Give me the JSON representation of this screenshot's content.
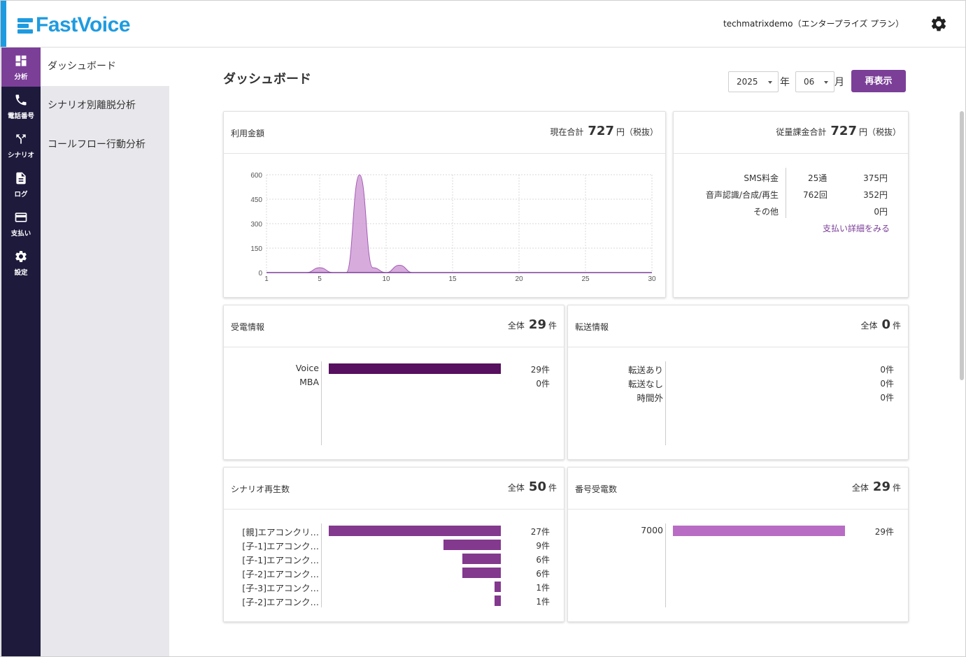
{
  "app": {
    "name": "FastVoice",
    "brand_color": "#1e9be0",
    "accent": "#7b3f98"
  },
  "header": {
    "account": "techmatrixdemo（エンタープライズ プラン）",
    "settings_icon": "gear-icon"
  },
  "rail": [
    {
      "label": "分析",
      "icon": "dashboard-icon"
    },
    {
      "label": "電話番号",
      "icon": "phone-icon"
    },
    {
      "label": "シナリオ",
      "icon": "fork-icon"
    },
    {
      "label": "ログ",
      "icon": "document-icon"
    },
    {
      "label": "支払い",
      "icon": "credit-card-icon"
    },
    {
      "label": "設定",
      "icon": "gear-icon"
    }
  ],
  "subnav": [
    "ダッシュボード",
    "シナリオ別離脱分析",
    "コールフロー行動分析"
  ],
  "page": {
    "title": "ダッシュボード",
    "year": "2025",
    "year_unit": "年",
    "month": "06",
    "month_unit": "月",
    "refresh": "再表示"
  },
  "usage": {
    "title": "利用金額",
    "total_label": "現在合計",
    "total": "727",
    "total_unit": "円（税抜）",
    "chart_data": {
      "type": "area",
      "x": [
        1,
        2,
        3,
        4,
        5,
        6,
        7,
        8,
        9,
        10,
        11,
        12,
        13,
        14,
        15,
        16,
        17,
        18,
        19,
        20,
        21,
        22,
        23,
        24,
        25,
        26,
        27,
        28,
        29,
        30
      ],
      "y": [
        0,
        0,
        0,
        0,
        30,
        0,
        0,
        600,
        30,
        0,
        45,
        0,
        0,
        0,
        0,
        0,
        0,
        0,
        0,
        0,
        0,
        0,
        0,
        0,
        0,
        0,
        0,
        0,
        0,
        0
      ],
      "xticks": [
        "1",
        "5",
        "10",
        "15",
        "20",
        "25",
        "30"
      ],
      "yticks": [
        "600",
        "450",
        "300",
        "150",
        "0"
      ],
      "ylim": [
        0,
        600
      ],
      "grid": true,
      "color": "#c990d2"
    }
  },
  "metered": {
    "title_label": "従量課金合計",
    "total": "727",
    "total_unit": "円（税抜）",
    "rows": [
      {
        "label": "SMS料金",
        "count": "25通",
        "amount": "375円"
      },
      {
        "label": "音声認識/合成/再生",
        "count": "762回",
        "amount": "352円"
      },
      {
        "label": "その他",
        "count": "",
        "amount": "0円"
      }
    ],
    "link": "支払い詳細をみる"
  },
  "incoming": {
    "title": "受電情報",
    "total_label": "全体",
    "total": "29",
    "unit": "件",
    "rows": [
      {
        "label": "Voice",
        "value": 29,
        "text": "29件"
      },
      {
        "label": "MBA",
        "value": 0,
        "text": "0件"
      }
    ],
    "max": 29,
    "color": "#570f5f"
  },
  "transfer": {
    "title": "転送情報",
    "total_label": "全体",
    "total": "0",
    "unit": "件",
    "rows": [
      {
        "label": "転送あり",
        "value": 0,
        "text": "0件"
      },
      {
        "label": "転送なし",
        "value": 0,
        "text": "0件"
      },
      {
        "label": "時間外",
        "value": 0,
        "text": "0件"
      }
    ],
    "max": 1,
    "color": "#7b3f98"
  },
  "scenario": {
    "title": "シナリオ再生数",
    "total_label": "全体",
    "total": "50",
    "unit": "件",
    "rows": [
      {
        "label": "[親]エアコンクリ…",
        "value": 27,
        "text": "27件"
      },
      {
        "label": "[子-1]エアコンク…",
        "value": 9,
        "text": "9件"
      },
      {
        "label": "[子-1]エアコンク…",
        "value": 6,
        "text": "6件"
      },
      {
        "label": "[子-2]エアコンク…",
        "value": 6,
        "text": "6件"
      },
      {
        "label": "[子-3]エアコンク…",
        "value": 1,
        "text": "1件"
      },
      {
        "label": "[子-2]エアコンク…",
        "value": 1,
        "text": "1件"
      }
    ],
    "max": 27,
    "color": "#83398e"
  },
  "number": {
    "title": "番号受電数",
    "total_label": "全体",
    "total": "29",
    "unit": "件",
    "rows": [
      {
        "label": "7000",
        "value": 29,
        "text": "29件"
      }
    ],
    "max": 29,
    "color": "#b86cc4"
  }
}
